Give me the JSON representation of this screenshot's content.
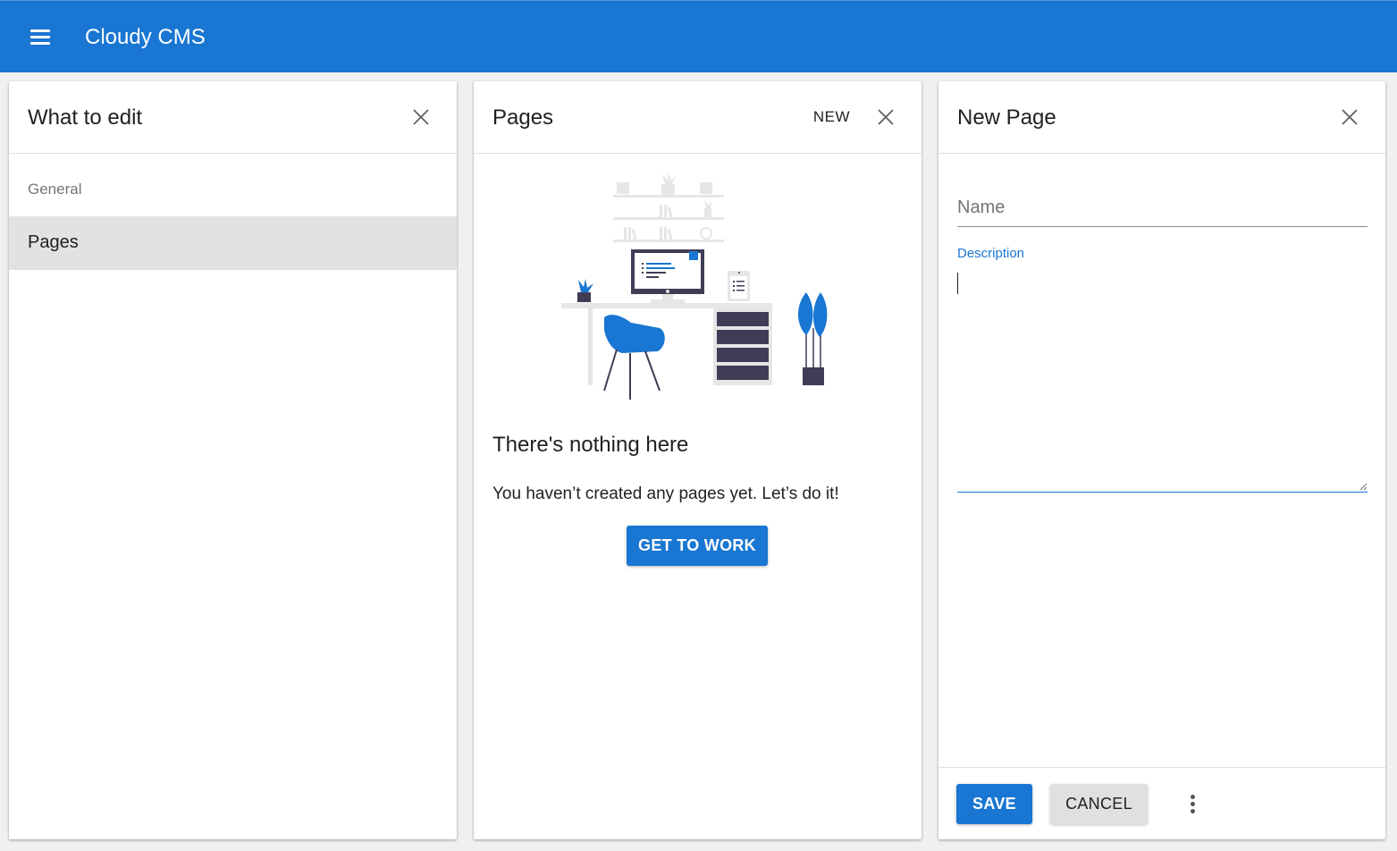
{
  "app": {
    "title": "Cloudy CMS"
  },
  "icons": {
    "menu": "menu-icon",
    "close": "close-icon",
    "more": "more-vert-icon"
  },
  "colors": {
    "primary": "#1976d2",
    "list_selected": "#e2e2e2",
    "secondary_button": "#e0e0e0"
  },
  "panels": {
    "what_to_edit": {
      "title": "What to edit",
      "sections": [
        {
          "subheader": "General",
          "items": [
            {
              "label": "Pages",
              "selected": true
            }
          ]
        }
      ]
    },
    "pages": {
      "title": "Pages",
      "new_label": "NEW",
      "empty_state": {
        "title": "There's nothing here",
        "text": "You haven’t created any pages yet. Let’s do it!",
        "button_label": "GET TO WORK"
      }
    },
    "new_page": {
      "title": "New Page",
      "name_field": {
        "label": "Name",
        "value": ""
      },
      "description_field": {
        "label": "Description",
        "value": ""
      },
      "save_label": "SAVE",
      "cancel_label": "CANCEL"
    }
  }
}
